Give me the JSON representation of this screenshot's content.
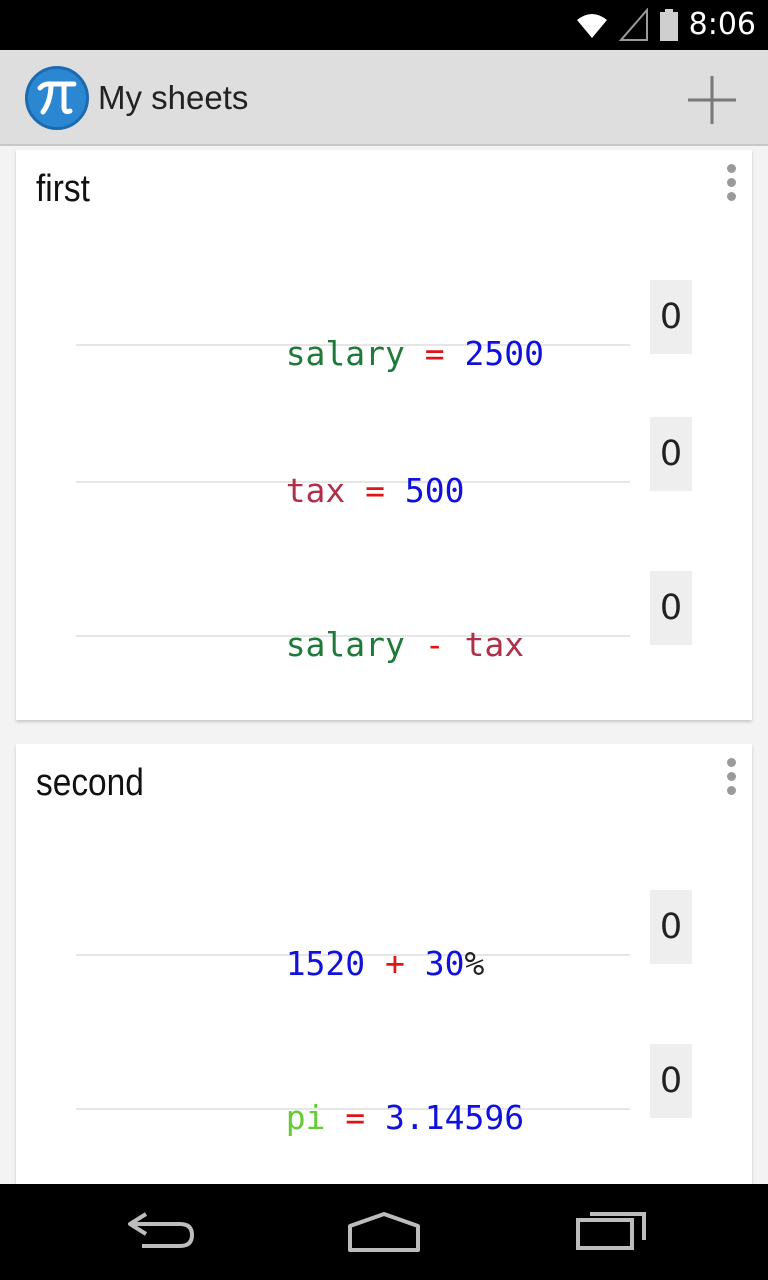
{
  "status_bar": {
    "time": "8:06",
    "icons": [
      "wifi-icon",
      "signal-icon",
      "battery-icon"
    ]
  },
  "action_bar": {
    "title": "My sheets",
    "logo_glyph": "π",
    "add_icon": "plus-icon"
  },
  "colors": {
    "accent": "#2b87d1",
    "variable_green": "#1f7a3a",
    "variable_maroon": "#b0304a",
    "variable_light_green": "#66cc33",
    "number_blue": "#1111dd",
    "operator_red": "#e01414",
    "plain_text": "#222222"
  },
  "sheets": [
    {
      "title": "first",
      "rows": [
        {
          "tokens": [
            {
              "text": "salary",
              "role": "variable_green"
            },
            {
              "text": " = ",
              "role": "operator_red"
            },
            {
              "text": "2500",
              "role": "number_blue"
            }
          ],
          "result": "0"
        },
        {
          "tokens": [
            {
              "text": "tax",
              "role": "variable_maroon"
            },
            {
              "text": " = ",
              "role": "operator_red"
            },
            {
              "text": "500",
              "role": "number_blue"
            }
          ],
          "result": "0"
        },
        {
          "tokens": [
            {
              "text": "salary",
              "role": "variable_green"
            },
            {
              "text": " - ",
              "role": "operator_red"
            },
            {
              "text": "tax",
              "role": "variable_maroon"
            }
          ],
          "result": "0"
        }
      ]
    },
    {
      "title": "second",
      "rows": [
        {
          "tokens": [
            {
              "text": "1520",
              "role": "number_blue"
            },
            {
              "text": " + ",
              "role": "operator_red"
            },
            {
              "text": "30",
              "role": "number_blue"
            },
            {
              "text": "%",
              "role": "plain_text"
            }
          ],
          "result": "0"
        },
        {
          "tokens": [
            {
              "text": "pi",
              "role": "variable_light_green"
            },
            {
              "text": " = ",
              "role": "operator_red"
            },
            {
              "text": "3.14596",
              "role": "number_blue"
            }
          ],
          "result": "0"
        }
      ]
    }
  ],
  "nav_bar": {
    "icons": [
      "back-icon",
      "home-icon",
      "recent-apps-icon"
    ]
  }
}
